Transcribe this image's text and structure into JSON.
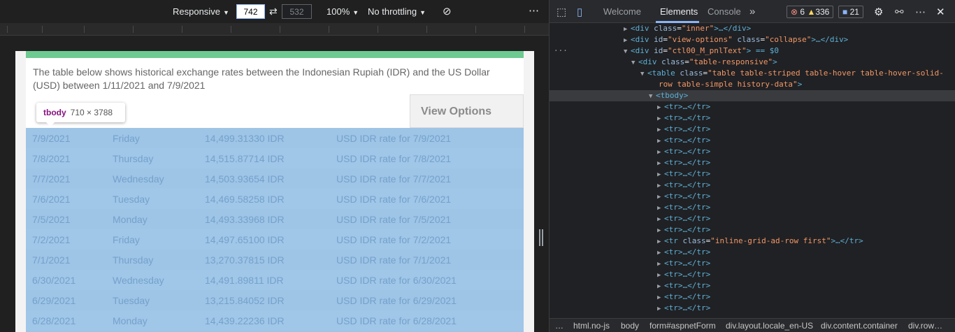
{
  "device_toolbar": {
    "mode": "Responsive",
    "width": "742",
    "height": "532",
    "zoom": "100%",
    "throttling": "No throttling",
    "more": "⋯"
  },
  "page": {
    "intro": "The table below shows historical exchange rates between the Indonesian Rupiah (IDR) and the US Dollar (USD) between 1/11/2021 and 7/9/2021",
    "view_options": "View Options"
  },
  "tooltip": {
    "tag": "tbody",
    "size": "710 × 3788"
  },
  "rows": [
    {
      "date": "7/9/2021",
      "day": "Friday",
      "rate": "14,499.31330 IDR",
      "desc": "USD IDR rate for 7/9/2021"
    },
    {
      "date": "7/8/2021",
      "day": "Thursday",
      "rate": "14,515.87714 IDR",
      "desc": "USD IDR rate for 7/8/2021"
    },
    {
      "date": "7/7/2021",
      "day": "Wednesday",
      "rate": "14,503.93654 IDR",
      "desc": "USD IDR rate for 7/7/2021"
    },
    {
      "date": "7/6/2021",
      "day": "Tuesday",
      "rate": "14,469.58258 IDR",
      "desc": "USD IDR rate for 7/6/2021"
    },
    {
      "date": "7/5/2021",
      "day": "Monday",
      "rate": "14,493.33968 IDR",
      "desc": "USD IDR rate for 7/5/2021"
    },
    {
      "date": "7/2/2021",
      "day": "Friday",
      "rate": "14,497.65100 IDR",
      "desc": "USD IDR rate for 7/2/2021"
    },
    {
      "date": "7/1/2021",
      "day": "Thursday",
      "rate": "13,270.37815 IDR",
      "desc": "USD IDR rate for 7/1/2021"
    },
    {
      "date": "6/30/2021",
      "day": "Wednesday",
      "rate": "14,491.89811 IDR",
      "desc": "USD IDR rate for 6/30/2021"
    },
    {
      "date": "6/29/2021",
      "day": "Tuesday",
      "rate": "13,215.84052 IDR",
      "desc": "USD IDR rate for 6/29/2021"
    },
    {
      "date": "6/28/2021",
      "day": "Monday",
      "rate": "14,439.22236 IDR",
      "desc": "USD IDR rate for 6/28/2021"
    }
  ],
  "devtools": {
    "tabs": [
      "Welcome",
      "Elements",
      "Console"
    ],
    "errors": "6",
    "warnings": "336",
    "messages": "21",
    "dom": {
      "inner": {
        "tag": "div",
        "attr": "class",
        "val": "\"inner\"",
        "tail": ">…</div>"
      },
      "view_options": {
        "tag": "div",
        "attr1": "id",
        "val1": "\"view-options\"",
        "attr2": "class",
        "val2": "\"collapse\"",
        "tail": ">…</div>"
      },
      "pnl": {
        "tag": "div",
        "attr": "id",
        "val": "\"ctl00_M_pnlText\"",
        "tail": "> == $0"
      },
      "responsive": {
        "tag": "div",
        "attr": "class",
        "val": "\"table-responsive\"",
        "tail": ">"
      },
      "table1": {
        "tag": "table",
        "attr": "class",
        "val": "\"table table-striped table-hover table-hover-solid-"
      },
      "table2": {
        "val": "row table-simple history-data\"",
        "tail": ">"
      },
      "tbody": "<tbody>",
      "tr": "<tr>…</tr>",
      "ad_row": {
        "tag": "tr",
        "attr": "class",
        "val": "\"inline-grid-ad-row first\"",
        "tail": ">…</tr>"
      }
    },
    "breadcrumbs": [
      "…",
      "html.no-js",
      "body",
      "form#aspnetForm",
      "div.layout.locale_en-US",
      "div.content.container",
      "div.row…"
    ]
  }
}
